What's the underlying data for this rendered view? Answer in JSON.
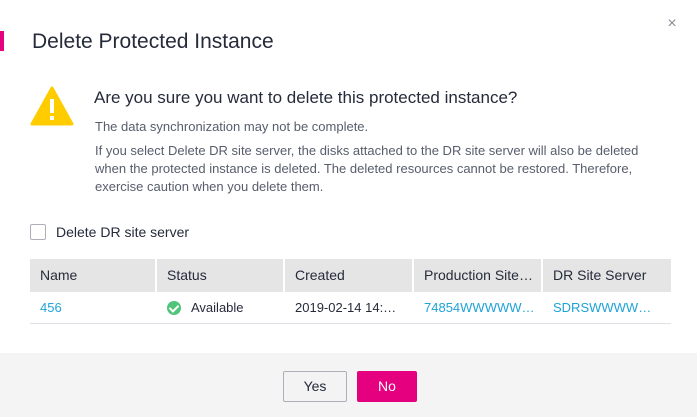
{
  "dialog": {
    "title": "Delete Protected Instance",
    "close_icon": "close-icon",
    "close_glyph": "×"
  },
  "warning": {
    "icon": "warning-icon",
    "question": "Are you sure you want to delete this protected instance?",
    "line1": "The data synchronization may not be complete.",
    "line2": "If you select Delete DR site server, the disks attached to the DR site server will also be deleted when the protected instance is deleted. The deleted resources cannot be restored. Therefore, exercise caution when you delete them."
  },
  "option": {
    "label": "Delete DR site server",
    "checked": false
  },
  "table": {
    "headers": [
      "Name",
      "Status",
      "Created",
      "Production Site…",
      "DR Site Server"
    ],
    "rows": [
      {
        "name": "456",
        "status": "Available",
        "status_icon": "check-circle-icon",
        "created": "2019-02-14 14:…",
        "production_site": "74854WWWWW…",
        "dr_site_server": "SDRSWWWWW…"
      }
    ]
  },
  "footer": {
    "yes_label": "Yes",
    "no_label": "No"
  },
  "colors": {
    "accent": "#e4007f",
    "link": "#1fa3d6",
    "success": "#50c478",
    "warning": "#ffcc00"
  }
}
